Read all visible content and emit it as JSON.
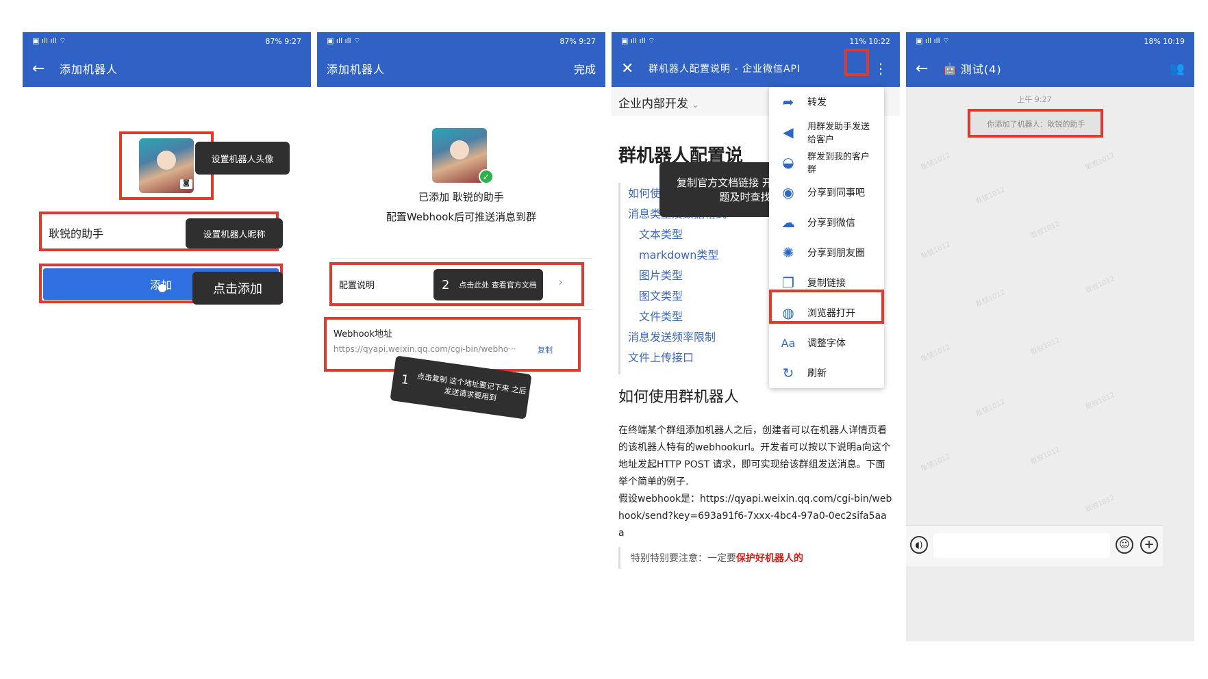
{
  "status": {
    "p1_right": "87% 9:27",
    "p2_right": "87% 9:27",
    "p3_right": "11% 10:22",
    "p4_right": "18% 10:19"
  },
  "panel1": {
    "title": "添加机器人",
    "avatar_tip": "设置机器人头像",
    "name_value": "耿锐的助手",
    "name_tip": "设置机器人昵称",
    "add_button": "添加",
    "add_tip": "点击添加"
  },
  "panel2": {
    "title": "添加机器人",
    "done": "完成",
    "added_text": "已添加 耿锐的助手",
    "hint": "配置Webhook后可推送消息到群",
    "config_label": "配置说明",
    "config_tip_num": "2",
    "config_tip": "点击此处 查看官方文档",
    "webhook_label": "Webhook地址",
    "webhook_url": "https://qyapi.weixin.qq.com/cgi-bin/webho···",
    "copy": "复制",
    "copy_tip_num": "1",
    "copy_tip": "点击复制 这个地址要记下来 之后发送请求要用到"
  },
  "panel3": {
    "title": "群机器人配置说明 - 企业微信API",
    "section": "企业内部开发",
    "heading": "群机器人配置说",
    "tip": "复制官方文档链接 开发遇到问题及时查找",
    "links": [
      "如何使用群机器人",
      "消息类型及数据格式",
      "文本类型",
      "markdown类型",
      "图片类型",
      "图文类型",
      "文件类型",
      "消息发送频率限制",
      "文件上传接口"
    ],
    "h2": "如何使用群机器人",
    "para": "在终端某个群组添加机器人之后，创建者可以在机器人详情页看的该机器人特有的webhookurl。开发者可以按以下说明a向这个地址发起HTTP POST 请求，即可实现给该群组发送消息。下面举个简单的例子.",
    "para2": "假设webhook是：https://qyapi.weixin.qq.com/cgi-bin/webhook/send?key=693a91f6-7xxx-4bc4-97a0-0ec2sifa5aaa",
    "note_prefix": "特别特别要注意：一定要",
    "note_red": "保护好机器人的",
    "menu": [
      "转发",
      "用群发助手发送给客户",
      "群发到我的客户群",
      "分享到同事吧",
      "分享到微信",
      "分享到朋友圈",
      "复制链接",
      "浏览器打开",
      "调整字体",
      "刷新"
    ]
  },
  "panel4": {
    "title": "测试(4)",
    "time": "上午 9:27",
    "system_msg": "你添加了机器人：耿锐的助手"
  }
}
